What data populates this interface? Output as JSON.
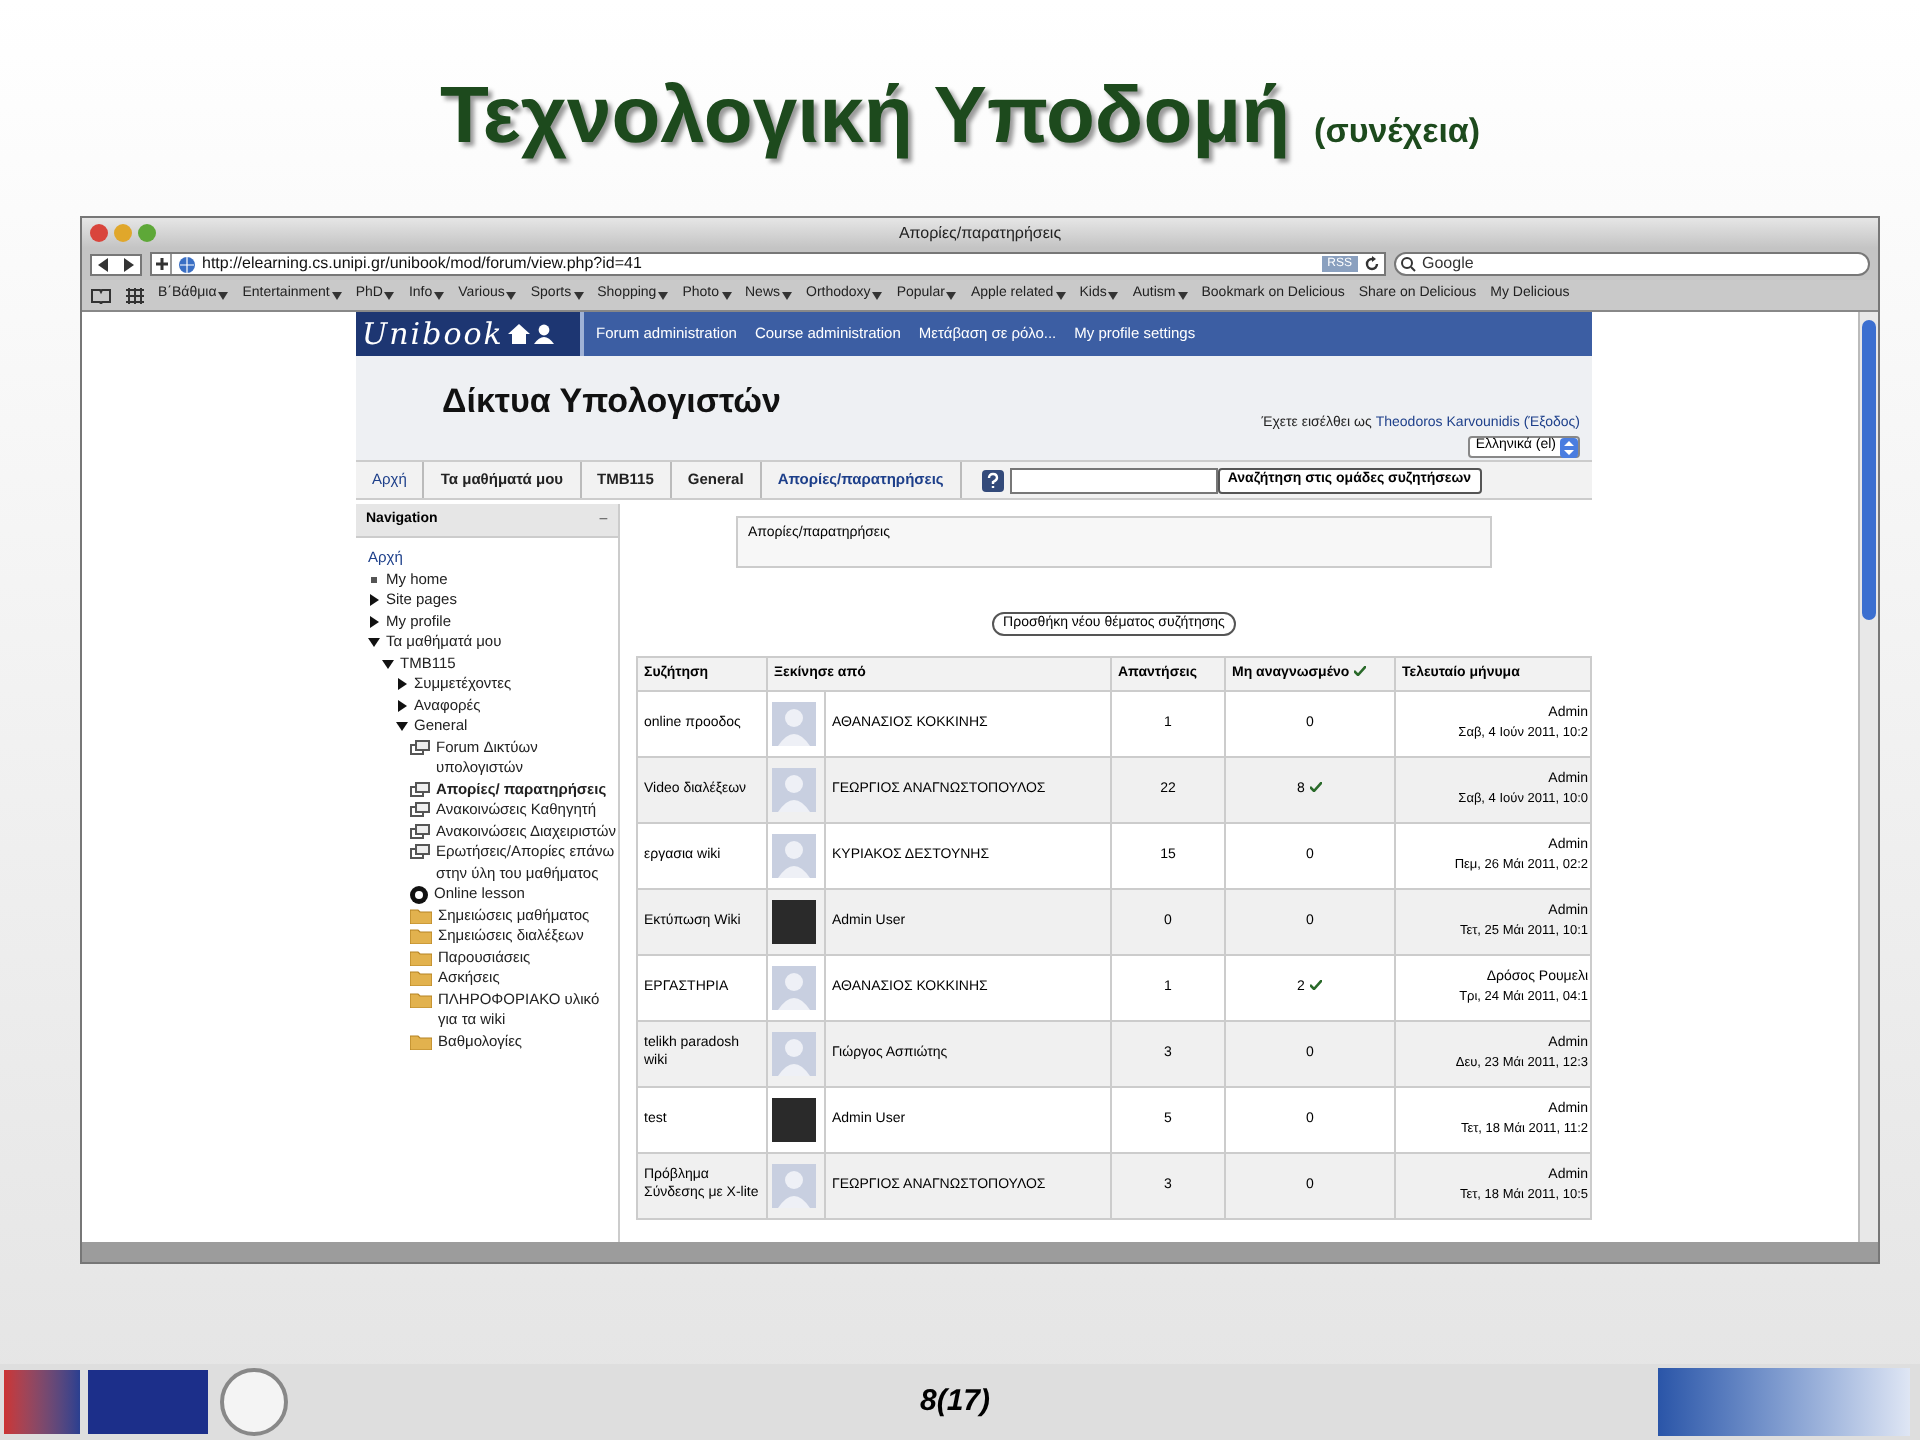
{
  "slide": {
    "title": "Τεχνολογική Υποδομή",
    "subtitle": "(συνέχεια)",
    "page_number": "8(17)"
  },
  "browser": {
    "window_title": "Απορίες/παρατηρήσεις",
    "url": "http://elearning.cs.unipi.gr/unibook/mod/forum/view.php?id=41",
    "rss": "RSS",
    "search_placeholder": "Google",
    "bookmarks": [
      {
        "label": "Β΄Βάθμια",
        "menu": true
      },
      {
        "label": "Entertainment",
        "menu": true
      },
      {
        "label": "PhD",
        "menu": true
      },
      {
        "label": "Info",
        "menu": true
      },
      {
        "label": "Various",
        "menu": true
      },
      {
        "label": "Sports",
        "menu": true
      },
      {
        "label": "Shopping",
        "menu": true
      },
      {
        "label": "Photo",
        "menu": true
      },
      {
        "label": "News",
        "menu": true
      },
      {
        "label": "Orthodoxy",
        "menu": true
      },
      {
        "label": "Popular",
        "menu": true
      },
      {
        "label": "Apple related",
        "menu": true
      },
      {
        "label": "Kids",
        "menu": true
      },
      {
        "label": "Autism",
        "menu": true
      },
      {
        "label": "Bookmark on Delicious",
        "menu": false
      },
      {
        "label": "Share on Delicious",
        "menu": false
      },
      {
        "label": "My Delicious",
        "menu": false
      }
    ]
  },
  "site": {
    "logo": "Unibook",
    "menu": [
      "Forum administration",
      "Course administration",
      "Μετάβαση σε ρόλο...",
      "My profile settings"
    ],
    "course_title": "Δίκτυα Υπολογιστών",
    "login_prefix": "Έχετε εισέλθει ως",
    "user": "Theodoros Karvounidis",
    "logout": "(Έξοδος)",
    "language": "Ελληνικά (el)",
    "breadcrumbs": [
      "Αρχή",
      "Τα μαθήματά μου",
      "TMB115",
      "General",
      "Απορίες/παρατηρήσεις"
    ],
    "search_button": "Αναζήτηση στις ομάδες συζητήσεων"
  },
  "navigation": {
    "title": "Navigation",
    "collapse": "−",
    "items": [
      {
        "label": "Αρχή",
        "kind": "link"
      },
      {
        "label": "My home",
        "kind": "bullet"
      },
      {
        "label": "Site pages",
        "kind": "branch",
        "expanded": false
      },
      {
        "label": "My profile",
        "kind": "branch",
        "expanded": false
      },
      {
        "label": "Τα μαθήματά μου",
        "kind": "branch",
        "expanded": true,
        "children": [
          {
            "label": "TMB115",
            "kind": "branch",
            "expanded": true,
            "children": [
              {
                "label": "Συμμετέχοντες",
                "kind": "branch",
                "expanded": false
              },
              {
                "label": "Αναφορές",
                "kind": "branch",
                "expanded": false
              },
              {
                "label": "General",
                "kind": "branch",
                "expanded": true,
                "children": [
                  {
                    "label": "Forum Δικτύων υπολογιστών",
                    "kind": "forum",
                    "selected": false
                  },
                  {
                    "label": "Απορίες/ παρατηρήσεις",
                    "kind": "forum",
                    "selected": true
                  },
                  {
                    "label": "Ανακοινώσεις Καθηγητή",
                    "kind": "forum",
                    "selected": false
                  },
                  {
                    "label": "Ανακοινώσεις Διαχειριστών",
                    "kind": "forum",
                    "selected": false
                  },
                  {
                    "label": "Ερωτήσεις/Απορίες επάνω στην ύλη του μαθήματος",
                    "kind": "forum",
                    "selected": false
                  },
                  {
                    "label": "Online lesson",
                    "kind": "lesson",
                    "selected": false
                  },
                  {
                    "label": "Σημειώσεις μαθήματος",
                    "kind": "folder",
                    "selected": false
                  },
                  {
                    "label": "Σημειώσεις διαλέξεων",
                    "kind": "folder",
                    "selected": false
                  },
                  {
                    "label": "Παρουσιάσεις",
                    "kind": "folder",
                    "selected": false
                  },
                  {
                    "label": "Ασκήσεις",
                    "kind": "folder",
                    "selected": false
                  },
                  {
                    "label": "ΠΛΗΡΟΦΟΡΙΑΚΟ υλικό για τα wiki",
                    "kind": "folder",
                    "selected": false
                  },
                  {
                    "label": "Βαθμολογίες",
                    "kind": "folder",
                    "selected": false
                  }
                ]
              }
            ]
          }
        ]
      }
    ]
  },
  "forum": {
    "intro": "Απορίες/παρατηρήσεις",
    "add_button": "Προσθήκη νέου θέματος συζήτησης",
    "columns": [
      "Συζήτηση",
      "Ξεκίνησε από",
      "Απαντήσεις",
      "Μη αναγνωσμένο",
      "Τελευταίο μήνυμα"
    ],
    "rows": [
      {
        "discussion": "online προοδος",
        "kind": "silhouette",
        "started_by": "ΑΘΑΝΑΣΙΟΣ ΚΟΚΚΙΝΗΣ",
        "replies": "1",
        "unread": "0",
        "unread_mark": false,
        "last_author": "Admin",
        "last_date": "Σαβ, 4 Ιούν 2011, 10:2"
      },
      {
        "discussion": "Video διαλέξεων",
        "kind": "silhouette",
        "started_by": "ΓΕΩΡΓΙΟΣ ΑΝΑΓΝΩΣΤΟΠΟΥΛΟΣ",
        "replies": "22",
        "unread": "8",
        "unread_mark": true,
        "last_author": "Admin",
        "last_date": "Σαβ, 4 Ιούν 2011, 10:0"
      },
      {
        "discussion": "εργασια wiki",
        "kind": "silhouette",
        "started_by": "ΚΥΡΙΑΚΟΣ ΔΕΣΤΟΥΝΗΣ",
        "replies": "15",
        "unread": "0",
        "unread_mark": false,
        "last_author": "Admin",
        "last_date": "Πεμ, 26 Μάι 2011, 02:2"
      },
      {
        "discussion": "Εκτύπωση Wiki",
        "kind": "photo",
        "started_by": "Admin User",
        "replies": "0",
        "unread": "0",
        "unread_mark": false,
        "last_author": "Admin",
        "last_date": "Τετ, 25 Μάι 2011, 10:1"
      },
      {
        "discussion": "ΕΡΓΑΣΤΗΡΙΑ",
        "kind": "silhouette",
        "started_by": "ΑΘΑΝΑΣΙΟΣ ΚΟΚΚΙΝΗΣ",
        "replies": "1",
        "unread": "2",
        "unread_mark": true,
        "last_author": "Δρόσος Ρουμελι",
        "last_date": "Τρι, 24 Μάι 2011, 04:1"
      },
      {
        "discussion": "telikh paradosh wiki",
        "kind": "silhouette",
        "started_by": "Γιώργος Ασπιώτης",
        "replies": "3",
        "unread": "0",
        "unread_mark": false,
        "last_author": "Admin",
        "last_date": "Δευ, 23 Μάι 2011, 12:3"
      },
      {
        "discussion": "test",
        "kind": "photo",
        "started_by": "Admin User",
        "replies": "5",
        "unread": "0",
        "unread_mark": false,
        "last_author": "Admin",
        "last_date": "Τετ, 18 Μάι 2011, 11:2"
      },
      {
        "discussion": "Πρόβλημα Σύνδεσης με X-lite",
        "kind": "silhouette",
        "started_by": "ΓΕΩΡΓΙΟΣ ΑΝΑΓΝΩΣΤΟΠΟΥΛΟΣ",
        "replies": "3",
        "unread": "0",
        "unread_mark": false,
        "last_author": "Admin",
        "last_date": "Τετ, 18 Μάι 2011, 10:5"
      }
    ]
  }
}
